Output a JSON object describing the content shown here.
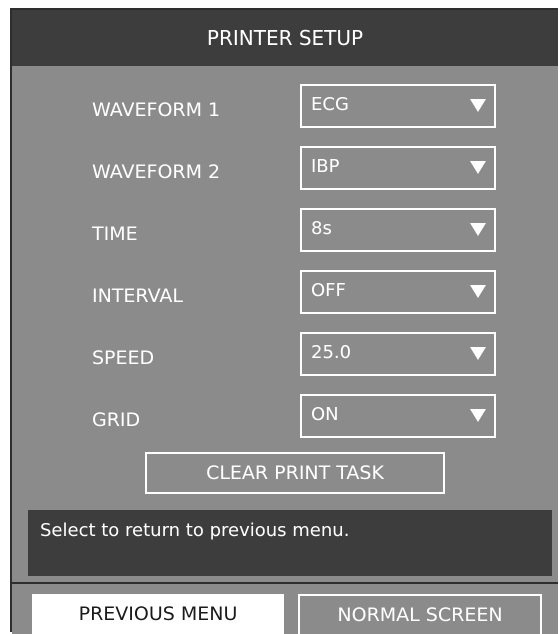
{
  "window": {
    "title": "PRINTER SETUP"
  },
  "settings": [
    {
      "label": "WAVEFORM 1",
      "value": "ECG"
    },
    {
      "label": "WAVEFORM 2",
      "value": "IBP"
    },
    {
      "label": "TIME",
      "value": "8s"
    },
    {
      "label": "INTERVAL",
      "value": "OFF"
    },
    {
      "label": "SPEED",
      "value": "25.0"
    },
    {
      "label": "GRID",
      "value": "ON"
    }
  ],
  "clear_button_label": "CLEAR PRINT TASK",
  "help_text": "Select to return to previous menu.",
  "footer": {
    "previous_menu_label": "PREVIOUS MENU",
    "normal_screen_label": "NORMAL SCREEN"
  },
  "icons": {
    "dropdown": "triangle-down-icon"
  },
  "colors": {
    "panel_bg": "#8b8b8b",
    "dark_bar": "#3d3d3d",
    "text": "#ffffff",
    "selected_button_bg": "#ffffff"
  }
}
